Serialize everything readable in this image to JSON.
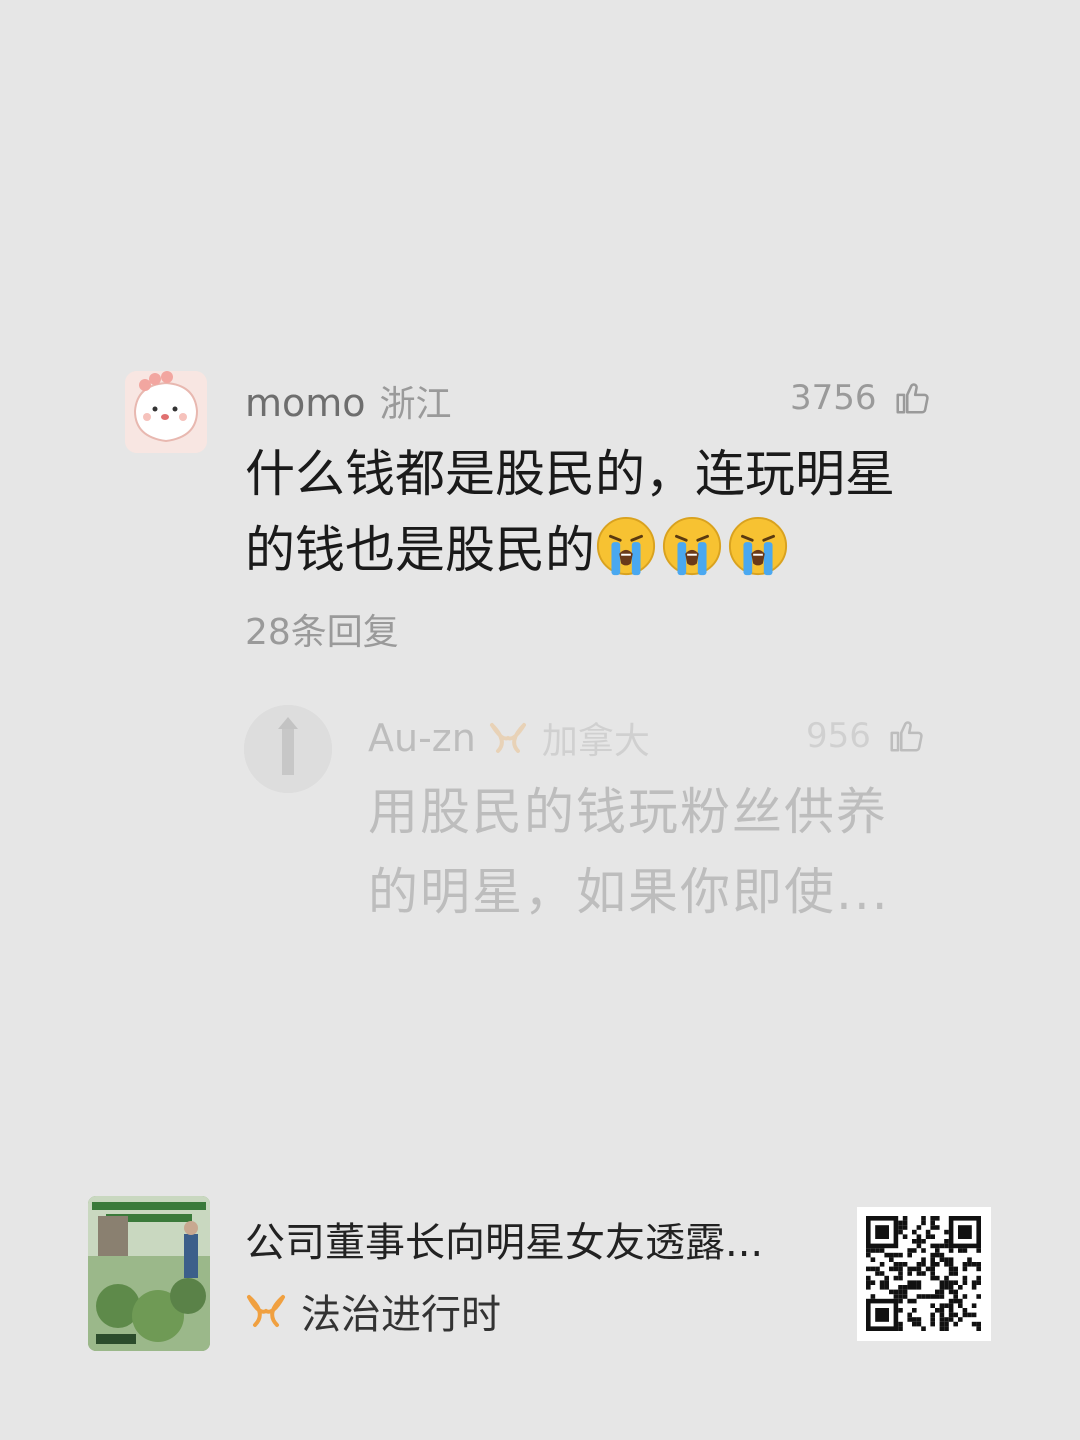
{
  "comment": {
    "username": "momo",
    "region": "浙江",
    "like_count": "3756",
    "text": "什么钱都是股民的，连玩明星的钱也是股民的",
    "emoji_count": 3,
    "emoji_icon": "loudly-crying-face-icon",
    "reply_count_label": "28条回复"
  },
  "reply": {
    "username": "Au-zn",
    "region": "加拿大",
    "like_count": "956",
    "text": "用股民的钱玩粉丝供养的明星，如果你即使..."
  },
  "card": {
    "title": "公司董事长向明星女友透露...",
    "source": "法治进行时",
    "brand_color": "#f0a040"
  },
  "colors": {
    "background": "#e6e6e6",
    "text_primary": "#1a1a1a",
    "text_secondary": "#9a9a9a"
  }
}
